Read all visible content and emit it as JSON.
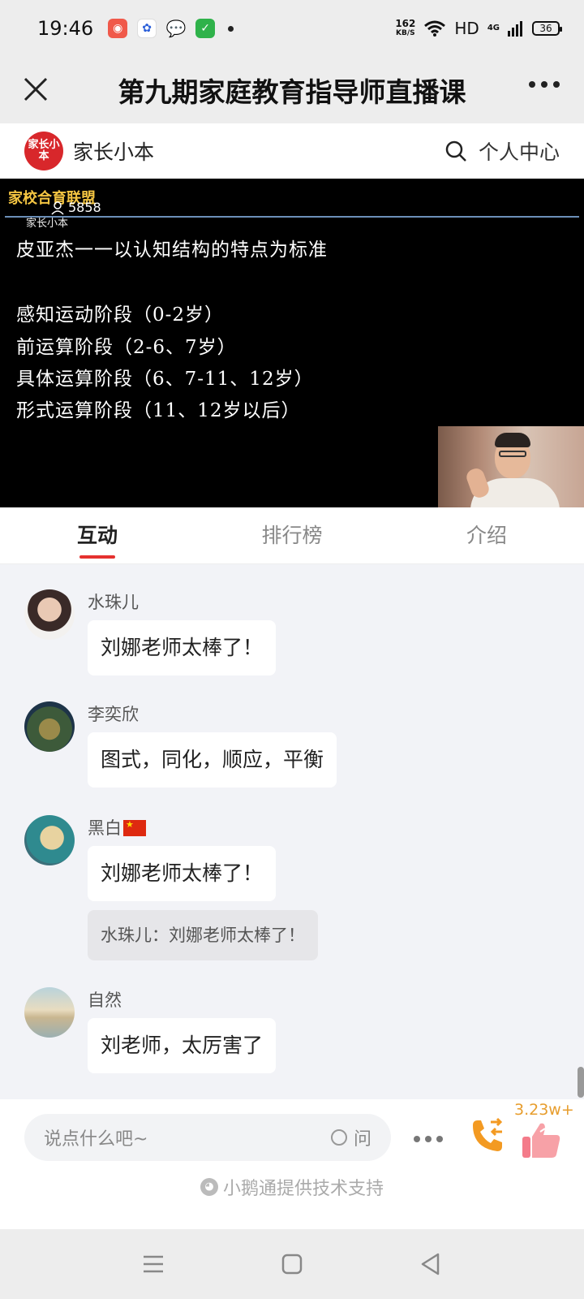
{
  "status_bar": {
    "time": "19:46",
    "net_speed": "162",
    "net_unit": "KB/S",
    "hd": "HD",
    "network": "4G",
    "battery": "36"
  },
  "title_bar": {
    "title": "第九期家庭教育指导师直播课",
    "close_icon": "close-icon",
    "more_icon": "more-icon"
  },
  "app_header": {
    "logo_text": "家长小本",
    "brand": "家长小本",
    "search_icon": "search-icon",
    "personal_center": "个人中心"
  },
  "video": {
    "watermark": "家校合育联盟",
    "watermark_sub": "家长小本",
    "viewer_count": "5858",
    "slide_lines": [
      "皮亚杰一一以认知结构的特点为标准",
      "感知运动阶段（0-2岁）",
      "前运算阶段（2-6、7岁）",
      "具体运算阶段（6、7-11、12岁）",
      "形式运算阶段（11、12岁以后）"
    ]
  },
  "tabs": [
    "互动",
    "排行榜",
    "介绍"
  ],
  "comments": [
    {
      "user": "水珠儿",
      "text": "刘娜老师太棒了！"
    },
    {
      "user": "李奕欣",
      "text": "图式，同化，顺应，平衡"
    },
    {
      "user": "黑白",
      "text": "刘娜老师太棒了！",
      "quote": "水珠儿：刘娜老师太棒了！"
    },
    {
      "user": "自然",
      "text": "刘老师，太厉害了"
    }
  ],
  "bottom": {
    "input_placeholder": "说点什么吧~",
    "ask_label": "问",
    "like_count": "3.23w+",
    "powered_by": "小鹅通提供技术支持"
  },
  "colors": {
    "accent_red": "#e5312f",
    "like_orange": "#e79d2d"
  }
}
